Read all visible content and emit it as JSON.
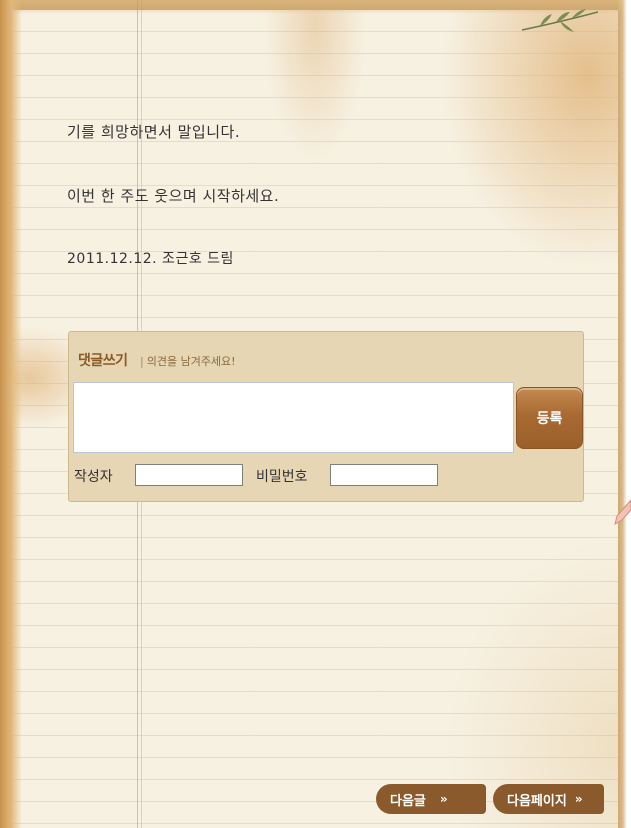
{
  "letter": {
    "line1": "기를 희망하면서 말입니다.",
    "line2": "이번 한 주도 웃으며 시작하세요.",
    "line3": "2011.12.12. 조근호 드림"
  },
  "comment": {
    "title": "댓글쓰기",
    "subtitle": "의견을 남겨주세요!",
    "submit_label": "등록",
    "author_label": "작성자",
    "password_label": "비밀번호",
    "textarea_value": "",
    "author_value": "",
    "password_value": ""
  },
  "nav": {
    "next_post": "다음글",
    "next_page": "다음페이지",
    "chevrons": "»"
  },
  "colors": {
    "accent": "#8a5a2c",
    "panel": "#e6d6b4",
    "paper": "#f7f1e2"
  },
  "icons": [
    "leaf-branch-icon",
    "scroll-up-icon",
    "scroll-down-icon",
    "chevron-right-double-icon",
    "pen-icon"
  ]
}
